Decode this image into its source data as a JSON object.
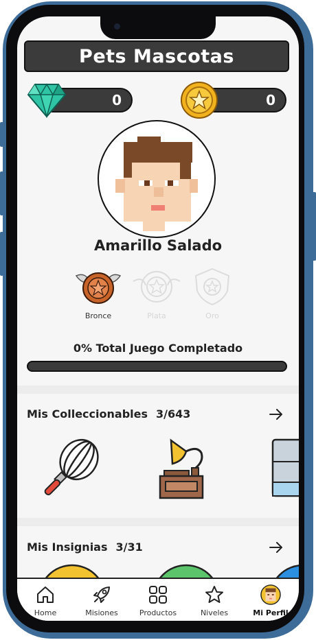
{
  "app": {
    "title": "Pets Mascotas"
  },
  "currencies": {
    "gems": "0",
    "coins": "0"
  },
  "profile": {
    "username": "Amarillo Salado"
  },
  "badges": [
    {
      "label": "Bronce",
      "active": true
    },
    {
      "label": "Plata",
      "active": false
    },
    {
      "label": "Oro",
      "active": false
    }
  ],
  "progress": {
    "text": "0% Total Juego Completado",
    "value": 0
  },
  "collectibles": {
    "title": "Mis Colleccionables",
    "count": "3/643",
    "items": [
      "whisk-icon",
      "gramophone-icon",
      "fridge-icon"
    ]
  },
  "insignias": {
    "title": "Mis Insignias",
    "count": "3/31"
  },
  "nav": {
    "items": [
      {
        "label": "Home",
        "icon": "home-icon"
      },
      {
        "label": "Misiones",
        "icon": "rocket-icon"
      },
      {
        "label": "Productos",
        "icon": "grid-icon"
      },
      {
        "label": "Niveles",
        "icon": "star-icon"
      },
      {
        "label": "Mi Perfil",
        "icon": "avatar-icon",
        "active": true
      }
    ]
  },
  "colors": {
    "frame": "#3e6c98",
    "bar": "#3b3b3b",
    "bronze": "#c8632a",
    "coin": "#f2c230",
    "gem": "#2fc4a3"
  }
}
